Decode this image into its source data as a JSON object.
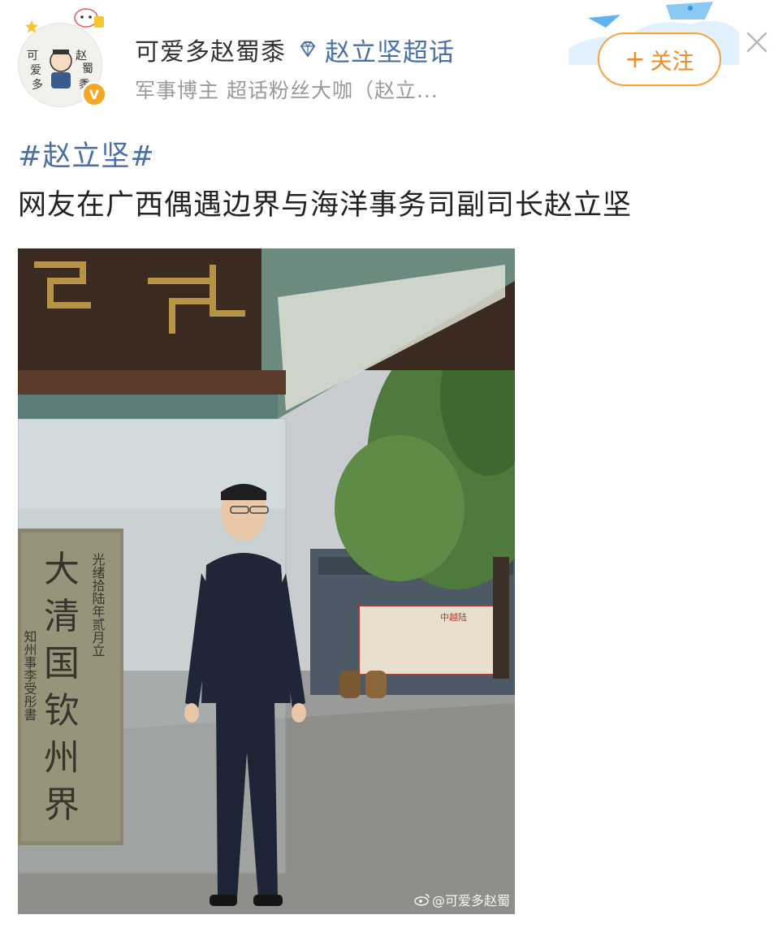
{
  "post": {
    "username": "可爱多赵蜀黍",
    "topic_link": "赵立坚超话",
    "subtitle": "军事博主 超话粉丝大咖（赵立...",
    "follow_label": "关注",
    "follow_plus": "+",
    "hashtag": "#赵立坚#",
    "text": "网友在广西偶遇边界与海洋事务司副司长赵立坚",
    "avatar_text": [
      "可",
      "爱",
      "多",
      "赵",
      "蜀",
      "黍"
    ],
    "verified_mark": "V"
  },
  "photo": {
    "stele_main": [
      "大",
      "清",
      "国",
      "钦",
      "州",
      "界"
    ],
    "stele_left_col": "知州事李受彤書",
    "stele_right_col": "光绪拾陆年贰月立",
    "plaque_title": "中越陆",
    "watermark": "@可爱多赵蜀"
  },
  "colors": {
    "link": "#4a6fa5",
    "follow_accent": "#f08a24",
    "verified": "#f5a623",
    "subtle": "#999999"
  },
  "icons": {
    "close": "close-icon",
    "diamond": "diamond-icon",
    "verified": "verified-badge-icon",
    "weibo": "weibo-logo-icon"
  }
}
